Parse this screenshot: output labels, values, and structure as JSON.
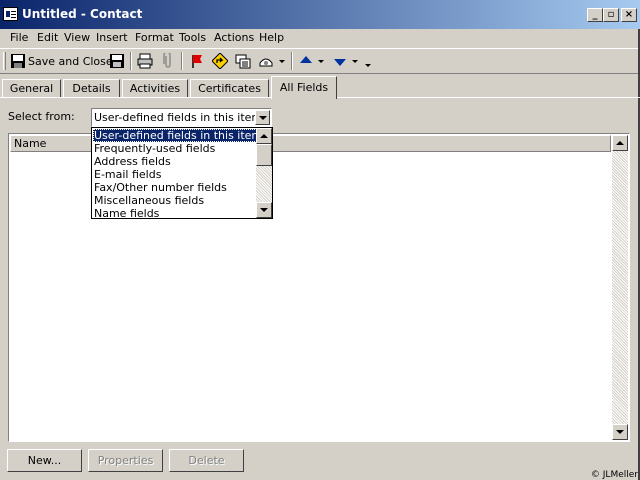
{
  "window": {
    "title": "Untitled - Contact",
    "min_glyph": "_",
    "max_glyph": "▫",
    "close_glyph": "×"
  },
  "menu": [
    "File",
    "Edit",
    "View",
    "Insert",
    "Format",
    "Tools",
    "Actions",
    "Help"
  ],
  "toolbar": {
    "save_close_label": "Save and Close"
  },
  "tabs": [
    "General",
    "Details",
    "Activities",
    "Certificates",
    "All Fields"
  ],
  "active_tab": "All Fields",
  "select_from": {
    "label": "Select from:",
    "value": "User-defined fields in this item",
    "options": [
      "User-defined fields in this item",
      "Frequently-used fields",
      "Address fields",
      "E-mail fields",
      "Fax/Other number fields",
      "Miscellaneous fields",
      "Name fields"
    ]
  },
  "grid": {
    "column_name": "Name"
  },
  "buttons": {
    "new": "New...",
    "properties": "Properties",
    "delete": "Delete"
  },
  "credit": "© JLMeller"
}
